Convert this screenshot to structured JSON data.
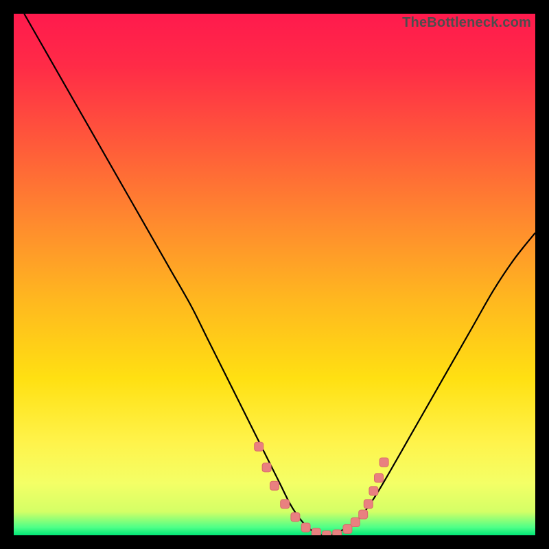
{
  "watermark": "TheBottleneck.com",
  "colors": {
    "bg": "#000000",
    "gradient_stops": [
      {
        "offset": 0.0,
        "color": "#ff1a4d"
      },
      {
        "offset": 0.1,
        "color": "#ff2b47"
      },
      {
        "offset": 0.25,
        "color": "#ff5a3a"
      },
      {
        "offset": 0.4,
        "color": "#ff8a2e"
      },
      {
        "offset": 0.55,
        "color": "#ffb81f"
      },
      {
        "offset": 0.7,
        "color": "#ffe012"
      },
      {
        "offset": 0.82,
        "color": "#fff34a"
      },
      {
        "offset": 0.9,
        "color": "#f4ff66"
      },
      {
        "offset": 0.955,
        "color": "#d4ff66"
      },
      {
        "offset": 0.985,
        "color": "#4dff88"
      },
      {
        "offset": 1.0,
        "color": "#00e676"
      }
    ],
    "curve": "#000000",
    "marker_fill": "#e98080",
    "marker_stroke": "#d86a6a"
  },
  "chart_data": {
    "type": "line",
    "title": "",
    "xlabel": "",
    "ylabel": "",
    "xlim": [
      0,
      100
    ],
    "ylim": [
      0,
      100
    ],
    "series": [
      {
        "name": "bottleneck-curve",
        "x": [
          2,
          6,
          10,
          14,
          18,
          22,
          26,
          30,
          34,
          37,
          40,
          43,
          46,
          49,
          51,
          53,
          55,
          57,
          59,
          61,
          63,
          66,
          69,
          72,
          76,
          80,
          84,
          88,
          92,
          96,
          100
        ],
        "y": [
          100,
          93,
          86,
          79,
          72,
          65,
          58,
          51,
          44,
          38,
          32,
          26,
          20,
          14,
          10,
          6,
          3,
          1,
          0,
          0,
          1,
          3,
          7,
          12,
          19,
          26,
          33,
          40,
          47,
          53,
          58
        ]
      }
    ],
    "markers": {
      "name": "highlight-dots",
      "x": [
        47,
        48.5,
        50,
        52,
        54,
        56,
        58,
        60,
        62,
        64,
        65.5,
        67,
        68,
        69,
        70,
        71
      ],
      "y": [
        17,
        13,
        9.5,
        6,
        3.5,
        1.5,
        0.5,
        0,
        0.2,
        1.2,
        2.5,
        4,
        6,
        8.5,
        11,
        14
      ]
    }
  }
}
